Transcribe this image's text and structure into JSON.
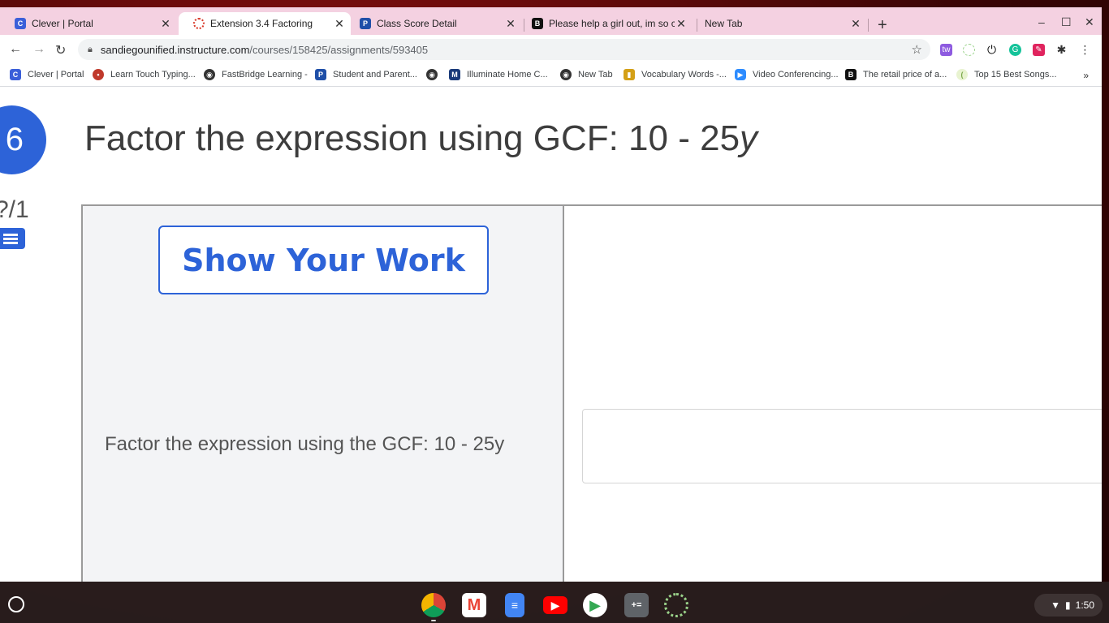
{
  "tabs": [
    {
      "title": "Clever | Portal",
      "icon": "clever-icon",
      "color": "#3b5fd9",
      "glyph": "C"
    },
    {
      "title": "Extension 3.4 Factoring",
      "icon": "canvas-icon",
      "color": "#d93a2b",
      "glyph": "",
      "active": true
    },
    {
      "title": "Class Score Detail",
      "icon": "powerschool-icon",
      "color": "#1f4fa8",
      "glyph": "P"
    },
    {
      "title": "Please help a girl out, im so conf",
      "icon": "brainly-icon",
      "color": "#111111",
      "glyph": "B"
    },
    {
      "title": "New Tab",
      "icon": "",
      "color": "",
      "glyph": ""
    }
  ],
  "window_controls": {
    "new_tab": "+",
    "minimize": "–",
    "maximize": "☐",
    "close": "✕",
    "tab_close": "✕"
  },
  "omnibox": {
    "host": "sandiegounified.instructure.com",
    "path": "/courses/158425/assignments/593405"
  },
  "bookmarks": [
    {
      "label": "Clever | Portal",
      "color": "#3b5fd9",
      "glyph": "C"
    },
    {
      "label": "Learn Touch Typing...",
      "color": "#c0392b",
      "glyph": "•"
    },
    {
      "label": "FastBridge Learning -",
      "color": "#333333",
      "glyph": "◉"
    },
    {
      "label": "Student and Parent...",
      "color": "#1f4fa8",
      "glyph": "P"
    },
    {
      "label": "",
      "color": "#333333",
      "glyph": "◉"
    },
    {
      "label": "Illuminate Home C...",
      "color": "#1a3a7a",
      "glyph": "M"
    },
    {
      "label": "New Tab",
      "color": "#333333",
      "glyph": "◉"
    },
    {
      "label": "Vocabulary Words -...",
      "color": "#d4a017",
      "glyph": "▮"
    },
    {
      "label": "Video Conferencing...",
      "color": "#2d8cff",
      "glyph": "▶"
    },
    {
      "label": "The retail price of a...",
      "color": "#111111",
      "glyph": "B"
    },
    {
      "label": "Top 15 Best Songs...",
      "color": "#e8f3d0",
      "glyph": "("
    }
  ],
  "bookmarks_more": "»",
  "question": {
    "number": "6",
    "title_text": "Factor the expression using GCF:  10 - 25",
    "title_var": "y",
    "score": "?/1",
    "show_work_label": "Show Your Work",
    "prompt": "Factor the expression using the GCF:  10 - 25y",
    "answer_value": ""
  },
  "shelf": {
    "apps": [
      "chrome-icon",
      "gmail-icon",
      "docs-icon",
      "youtube-icon",
      "play-store-icon",
      "calculator-icon",
      "loading-icon"
    ],
    "time": "1:50"
  },
  "colors": {
    "accent": "#2d63d8",
    "tab_strip": "#f4d1e1"
  }
}
